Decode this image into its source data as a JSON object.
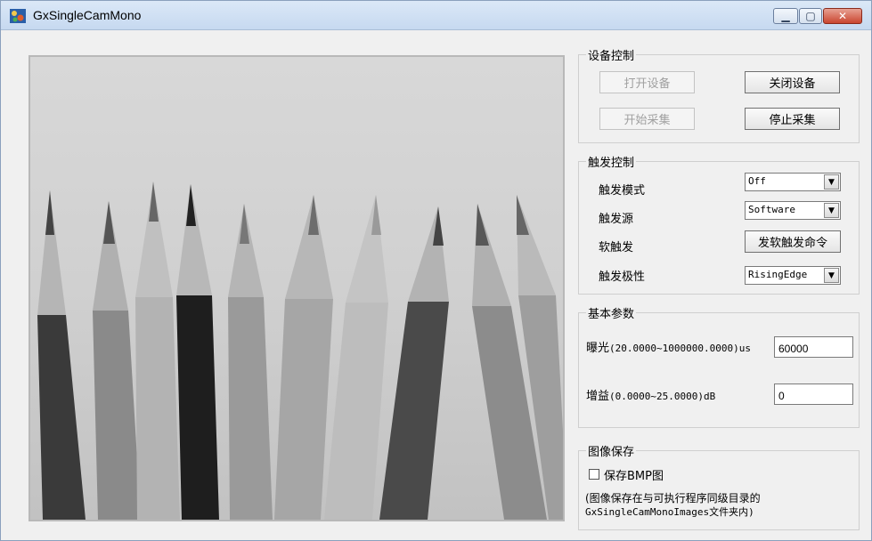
{
  "window": {
    "title": "GxSingleCamMono"
  },
  "device_control": {
    "legend": "设备控制",
    "open_device": "打开设备",
    "close_device": "关闭设备",
    "start_capture": "开始采集",
    "stop_capture": "停止采集"
  },
  "trigger_control": {
    "legend": "触发控制",
    "mode_label": "触发模式",
    "mode_value": "Off",
    "source_label": "触发源",
    "source_value": "Software",
    "soft_label": "软触发",
    "soft_button": "发软触发命令",
    "polarity_label": "触发极性",
    "polarity_value": "RisingEdge"
  },
  "basic_params": {
    "legend": "基本参数",
    "exposure_label_cn": "曝光",
    "exposure_range": "(20.0000~1000000.0000)us",
    "exposure_value": "60000",
    "gain_label_cn": "增益",
    "gain_range": "(0.0000~25.0000)dB",
    "gain_value": "0"
  },
  "image_save": {
    "legend": "图像保存",
    "checkbox_label": "保存BMP图",
    "checked": false,
    "note_line1": "(图像保存在与可执行程序同级目录的",
    "note_line2": "GxSingleCamMonoImages文件夹内)"
  }
}
